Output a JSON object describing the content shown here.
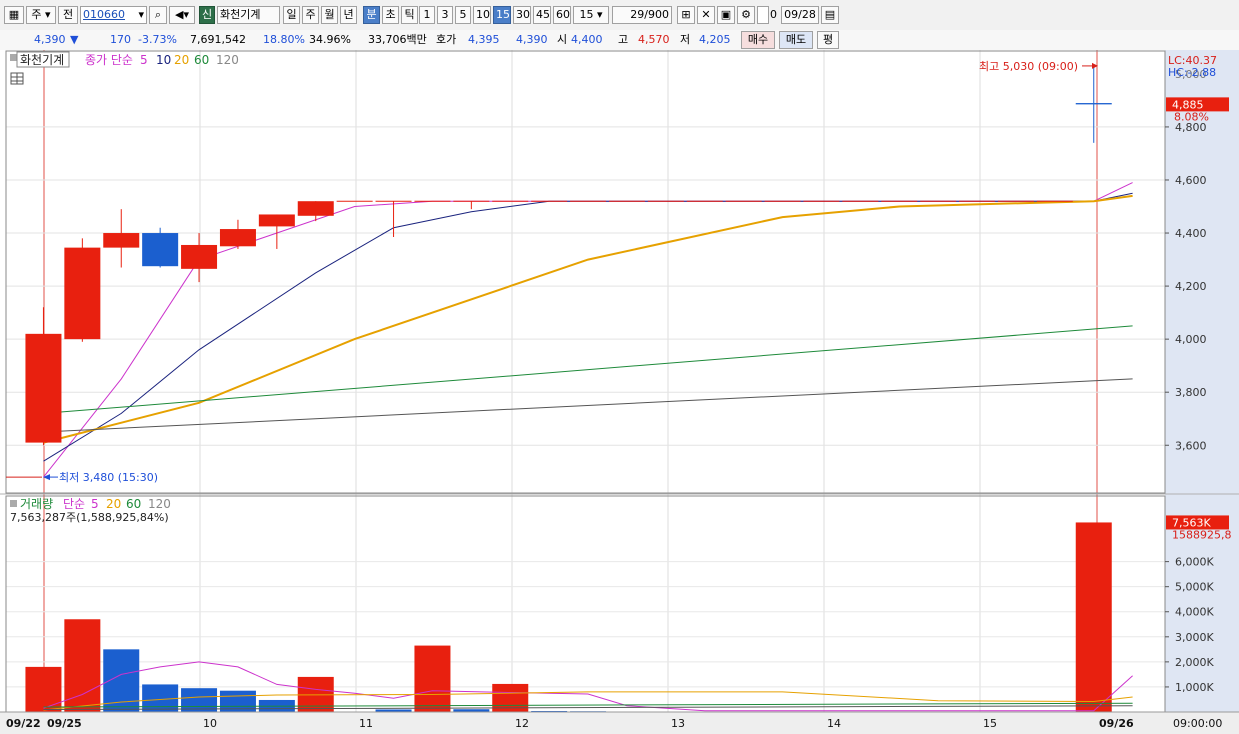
{
  "toolbar": {
    "period_select": "주",
    "prev_label": "전",
    "code": "010660",
    "shin_badge": "신",
    "stock_name": "화천기계",
    "periods": [
      "일",
      "주",
      "월",
      "년",
      "분",
      "초",
      "틱"
    ],
    "active_period": "분",
    "intervals": [
      "1",
      "3",
      "5",
      "10",
      "15",
      "30",
      "45",
      "60"
    ],
    "active_interval": "15",
    "interval_select": "15",
    "count": "29/900",
    "zero_check_label": "0",
    "date": "09/28"
  },
  "quote": {
    "price": "4,390",
    "change_arrow": "▼",
    "change": "170",
    "change_pct": "-3.73%",
    "volume": "7,691,542",
    "ratio1": "18.80%",
    "ratio2": "34.96%",
    "amount": "33,706백만",
    "hoga_label": "호가",
    "ask": "4,395",
    "bid": "4,390",
    "open_label": "시",
    "open": "4,400",
    "high_label": "고",
    "high": "4,570",
    "low_label": "저",
    "low": "4,205",
    "buy_label": "매수",
    "sell_label": "매도",
    "avg_label": "평"
  },
  "price_panel": {
    "legend_name": "화천기계",
    "legend_ma_label": "종가 단순",
    "legend_ma_periods": [
      "5",
      "10",
      "20",
      "60",
      "120"
    ],
    "lc": "LC:40.37",
    "hc": "HC:-2.88",
    "current_price_label": "4,885",
    "current_pct": "8.08%",
    "max_annotation": "최고 5,030 (09:00)",
    "min_annotation": "최저 3,480 (15:30)",
    "y_ticks": [
      "4,800",
      "4,600",
      "4,400",
      "4,200",
      "4,000",
      "3,800",
      "3,600"
    ],
    "top_partial_tick": "5,000"
  },
  "volume_panel": {
    "legend_name": "거래량",
    "legend_ma_label": "단순",
    "legend_ma_periods": [
      "5",
      "20",
      "60",
      "120"
    ],
    "info": "7,563,287주(1,588,925,84%)",
    "current_label": "7,563K",
    "current_sub": "1588925,8",
    "y_ticks": [
      "6,000K",
      "5,000K",
      "4,000K",
      "3,000K",
      "2,000K",
      "1,000K"
    ]
  },
  "x_axis": {
    "labels": [
      "09/22",
      "09/25",
      "10",
      "11",
      "12",
      "13",
      "14",
      "15",
      "09/26"
    ],
    "time_label": "09:00:00"
  },
  "colors": {
    "up": "#e8200f",
    "down": "#1b5fcf",
    "ma5": "#cc33cc",
    "ma10": "#1a237e",
    "ma20": "#e6a100",
    "ma60": "#1e8a3a",
    "ma120": "#555555"
  },
  "chart_data": {
    "type": "candlestick",
    "title": "화천기계",
    "price_range": [
      3420,
      5090
    ],
    "candles": [
      {
        "o": 3610,
        "h": 4120,
        "l": 3600,
        "c": 4020
      },
      {
        "o": 4000,
        "h": 4380,
        "l": 3990,
        "c": 4345
      },
      {
        "o": 4345,
        "h": 4490,
        "l": 4270,
        "c": 4400
      },
      {
        "o": 4400,
        "h": 4420,
        "l": 4270,
        "c": 4275
      },
      {
        "o": 4265,
        "h": 4400,
        "l": 4215,
        "c": 4355
      },
      {
        "o": 4350,
        "h": 4450,
        "l": 4340,
        "c": 4415
      },
      {
        "o": 4425,
        "h": 4470,
        "l": 4340,
        "c": 4470
      },
      {
        "o": 4465,
        "h": 4520,
        "l": 4445,
        "c": 4520
      },
      {
        "o": 4520,
        "h": 4520,
        "l": 4520,
        "c": 4520
      },
      {
        "o": 4520,
        "h": 4520,
        "l": 4385,
        "c": 4520
      },
      {
        "o": 4520,
        "h": 4520,
        "l": 4520,
        "c": 4520
      },
      {
        "o": 4520,
        "h": 4520,
        "l": 4490,
        "c": 4520
      },
      {
        "o": 4520,
        "h": 4520,
        "l": 4520,
        "c": 4520
      },
      {
        "o": 4520,
        "h": 4520,
        "l": 4520,
        "c": 4520
      },
      {
        "o": 4520,
        "h": 4520,
        "l": 4520,
        "c": 4520
      },
      {
        "o": 4520,
        "h": 4520,
        "l": 4520,
        "c": 4520
      },
      {
        "o": 4520,
        "h": 4520,
        "l": 4520,
        "c": 4520
      },
      {
        "o": 4520,
        "h": 4520,
        "l": 4520,
        "c": 4520
      },
      {
        "o": 4520,
        "h": 4520,
        "l": 4520,
        "c": 4520
      },
      {
        "o": 4520,
        "h": 4520,
        "l": 4520,
        "c": 4520
      },
      {
        "o": 4520,
        "h": 4520,
        "l": 4520,
        "c": 4520
      },
      {
        "o": 4520,
        "h": 4520,
        "l": 4520,
        "c": 4520
      },
      {
        "o": 4520,
        "h": 4520,
        "l": 4520,
        "c": 4520
      },
      {
        "o": 4520,
        "h": 4520,
        "l": 4520,
        "c": 4520
      },
      {
        "o": 4520,
        "h": 4520,
        "l": 4520,
        "c": 4520
      },
      {
        "o": 4520,
        "h": 4520,
        "l": 4520,
        "c": 4520
      },
      {
        "o": 4520,
        "h": 4520,
        "l": 4520,
        "c": 4520
      },
      {
        "o": 4890,
        "h": 5030,
        "l": 4740,
        "c": 4885
      }
    ],
    "ma_series": [
      {
        "name": "5",
        "points": [
          [
            0,
            3480
          ],
          [
            2,
            3850
          ],
          [
            4,
            4300
          ],
          [
            6,
            4400
          ],
          [
            8,
            4500
          ],
          [
            10,
            4520
          ],
          [
            27,
            4520
          ],
          [
            28,
            4590
          ]
        ]
      },
      {
        "name": "10",
        "points": [
          [
            0,
            3540
          ],
          [
            2,
            3720
          ],
          [
            4,
            3960
          ],
          [
            7,
            4250
          ],
          [
            9,
            4420
          ],
          [
            11,
            4480
          ],
          [
            13,
            4520
          ],
          [
            27,
            4520
          ],
          [
            28,
            4550
          ]
        ]
      },
      {
        "name": "20",
        "points": [
          [
            0,
            3610
          ],
          [
            4,
            3760
          ],
          [
            8,
            4000
          ],
          [
            14,
            4300
          ],
          [
            19,
            4460
          ],
          [
            22,
            4500
          ],
          [
            27,
            4520
          ],
          [
            28,
            4540
          ]
        ]
      },
      {
        "name": "60",
        "points": [
          [
            0,
            3720
          ],
          [
            28,
            4050
          ]
        ]
      },
      {
        "name": "120",
        "points": [
          [
            0,
            3650
          ],
          [
            28,
            3850
          ]
        ]
      }
    ],
    "volume_unit": "K",
    "volume_range": [
      0,
      7563
    ],
    "volumes": [
      {
        "v": 1800,
        "dir": "up"
      },
      {
        "v": 3700,
        "dir": "up"
      },
      {
        "v": 2500,
        "dir": "down"
      },
      {
        "v": 1100,
        "dir": "down"
      },
      {
        "v": 950,
        "dir": "down"
      },
      {
        "v": 850,
        "dir": "down"
      },
      {
        "v": 480,
        "dir": "down"
      },
      {
        "v": 1400,
        "dir": "up"
      },
      {
        "v": 0,
        "dir": "up"
      },
      {
        "v": 100,
        "dir": "down"
      },
      {
        "v": 2650,
        "dir": "up"
      },
      {
        "v": 110,
        "dir": "down"
      },
      {
        "v": 1120,
        "dir": "up"
      },
      {
        "v": 40,
        "dir": "down"
      },
      {
        "v": 30,
        "dir": "down"
      },
      {
        "v": 20,
        "dir": "down"
      },
      {
        "v": 20,
        "dir": "down"
      },
      {
        "v": 20,
        "dir": "down"
      },
      {
        "v": 20,
        "dir": "down"
      },
      {
        "v": 20,
        "dir": "down"
      },
      {
        "v": 20,
        "dir": "down"
      },
      {
        "v": 20,
        "dir": "down"
      },
      {
        "v": 20,
        "dir": "down"
      },
      {
        "v": 20,
        "dir": "down"
      },
      {
        "v": 20,
        "dir": "down"
      },
      {
        "v": 20,
        "dir": "down"
      },
      {
        "v": 20,
        "dir": "down"
      },
      {
        "v": 7563,
        "dir": "up"
      }
    ],
    "volume_ma_series": [
      {
        "name": "5",
        "points": [
          [
            0,
            150
          ],
          [
            1,
            700
          ],
          [
            2,
            1500
          ],
          [
            3,
            1800
          ],
          [
            4,
            2000
          ],
          [
            5,
            1800
          ],
          [
            6,
            1100
          ],
          [
            7,
            900
          ],
          [
            8,
            750
          ],
          [
            9,
            550
          ],
          [
            10,
            850
          ],
          [
            12,
            780
          ],
          [
            14,
            720
          ],
          [
            15,
            250
          ],
          [
            17,
            50
          ],
          [
            27,
            50
          ],
          [
            28,
            1450
          ]
        ]
      },
      {
        "name": "20",
        "points": [
          [
            0,
            80
          ],
          [
            2,
            400
          ],
          [
            4,
            600
          ],
          [
            6,
            680
          ],
          [
            10,
            700
          ],
          [
            14,
            800
          ],
          [
            19,
            800
          ],
          [
            23,
            450
          ],
          [
            27,
            420
          ],
          [
            28,
            600
          ]
        ]
      },
      {
        "name": "60",
        "points": [
          [
            0,
            200
          ],
          [
            28,
            350
          ]
        ]
      },
      {
        "name": "120",
        "points": [
          [
            0,
            100
          ],
          [
            28,
            250
          ]
        ]
      }
    ]
  }
}
